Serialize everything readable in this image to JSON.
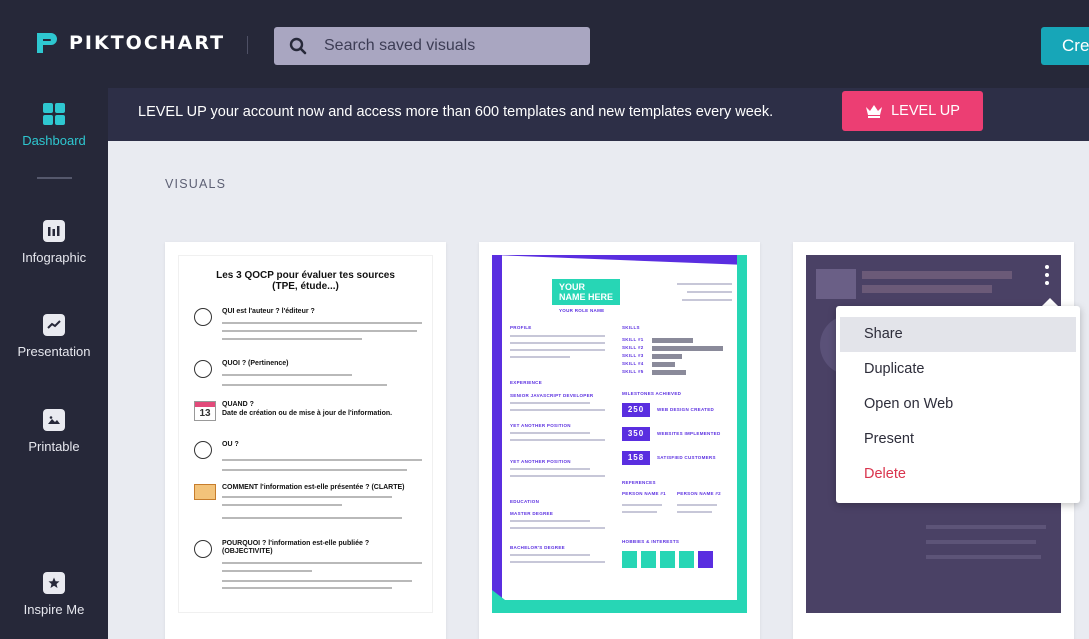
{
  "header": {
    "logo_text": "PIKTOCHART",
    "search_placeholder": "Search saved visuals",
    "create_label": "Cre"
  },
  "sidebar": {
    "items": [
      {
        "label": "Dashboard",
        "icon": "grid-icon"
      },
      {
        "label": "Infographic",
        "icon": "infographic-icon"
      },
      {
        "label": "Presentation",
        "icon": "presentation-icon"
      },
      {
        "label": "Printable",
        "icon": "printable-icon"
      },
      {
        "label": "Inspire Me",
        "icon": "star-icon"
      }
    ]
  },
  "banner": {
    "text": "LEVEL UP your account now and access more than 600 templates and new templates every week.",
    "button_label": "LEVEL UP"
  },
  "main": {
    "section_title": "VISUALS"
  },
  "cards": [
    {
      "doc_title_1": "Les 3 QOCP pour évaluer tes sources",
      "doc_title_2": "(TPE, étude...)",
      "headings": [
        "QUI est l'auteur ? l'éditeur ?",
        "QUOI ? (Pertinence)",
        "QUAND ?",
        "Date de création ou de mise à jour de l'information.",
        "OU ?",
        "COMMENT l'information est-elle présentée ? (CLARTE)",
        "POURQUOI ? l'information est-elle publiée ?",
        "(OBJECTIVITE)"
      ],
      "date_badge": "13"
    },
    {
      "name_1": "YOUR",
      "name_2": "NAME HERE",
      "role": "YOUR ROLE NAME",
      "sections": [
        "PROFILE",
        "EXPERIENCE",
        "EDUCATION",
        "SKILLS",
        "MILESTONES ACHIEVED",
        "REFERENCES",
        "HOBBIES & INTERESTS"
      ],
      "jobs": [
        "SENIOR JAVASCRIPT DEVELOPER",
        "YET ANOTHER POSITION",
        "YET ANOTHER POSITION"
      ],
      "degrees": [
        "MASTER DEGREE",
        "BACHELOR'S DEGREE"
      ],
      "skills": [
        "SKILL #1",
        "SKILL #2",
        "SKILL #3",
        "SKILL #4",
        "SKILL #5"
      ],
      "skill_levels": [
        0.55,
        0.95,
        0.4,
        0.3,
        0.45
      ],
      "milestones": [
        {
          "value": "250",
          "label": "WEB DESIGN CREATED"
        },
        {
          "value": "350",
          "label": "WEBSITES IMPLEMENTED"
        },
        {
          "value": "158",
          "label": "SATISFIED CUSTOMERS"
        }
      ],
      "references": [
        "PERSON NAME #1",
        "PERSON NAME #2"
      ]
    },
    {}
  ],
  "context_menu": {
    "items": [
      "Share",
      "Duplicate",
      "Open on Web",
      "Present",
      "Delete"
    ]
  },
  "colors": {
    "topbar": "#262839",
    "banner": "#2d2f47",
    "accent_teal": "#17a6b8",
    "level_up_pink": "#ec3e73",
    "delete_red": "#d9344d",
    "resume_purple": "#5a2ee0",
    "resume_teal": "#27d6b5"
  }
}
